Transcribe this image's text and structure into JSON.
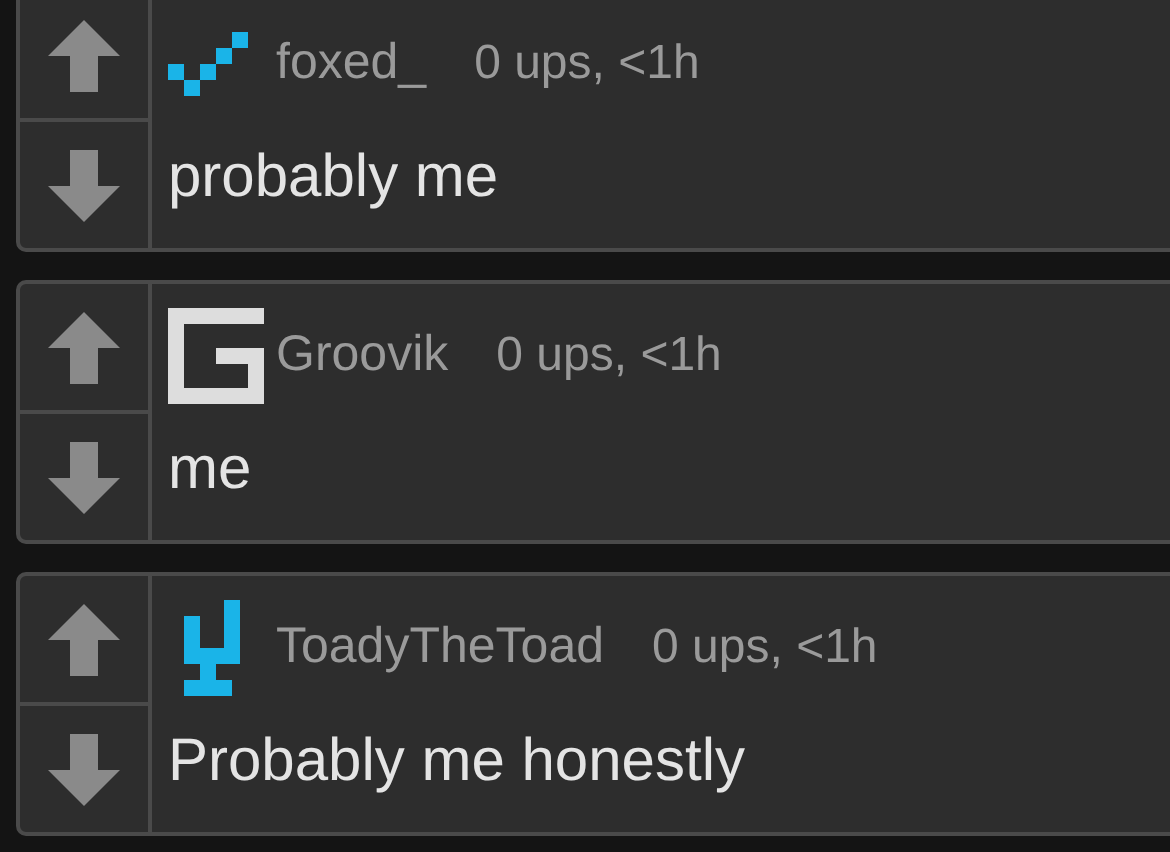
{
  "comments": [
    {
      "avatar": {
        "kind": "steps",
        "color": "#1ab4e8"
      },
      "username": "foxed_",
      "meta": "0 ups, <1h",
      "text": "probably me"
    },
    {
      "avatar": {
        "kind": "g",
        "color": "#dddddd"
      },
      "username": "Groovik",
      "meta": "0 ups, <1h",
      "text": "me"
    },
    {
      "avatar": {
        "kind": "tee",
        "color": "#1ab4e8"
      },
      "username": "ToadyTheToad",
      "meta": "0 ups, <1h",
      "text": "Probably me honestly"
    }
  ]
}
